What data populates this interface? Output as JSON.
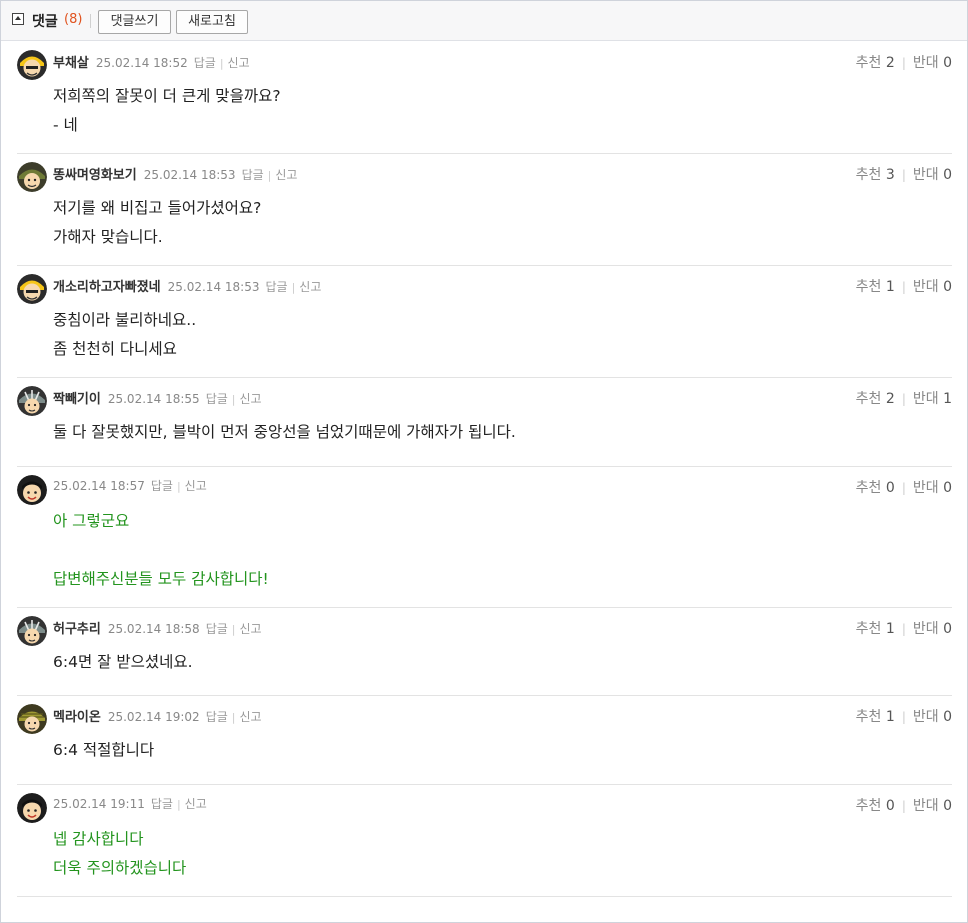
{
  "header": {
    "title": "댓글",
    "count": "(8)",
    "write_button": "댓글쓰기",
    "refresh_button": "새로고침"
  },
  "labels": {
    "reply": "답글",
    "report": "신고",
    "recommend": "추천",
    "oppose": "반대"
  },
  "comments": [
    {
      "nick": "부채살",
      "date": "25.02.14 18:52",
      "lines": [
        "저희쪽의 잘못이 더 큰게 맞을까요?",
        "- 네"
      ],
      "up": "2",
      "down": "0",
      "author": false,
      "avatar": "yellow-helmet-avatar"
    },
    {
      "nick": "똥싸며영화보기",
      "date": "25.02.14 18:53",
      "lines": [
        "저기를 왜 비집고 들어가셨어요?",
        "가해자 맞습니다."
      ],
      "up": "3",
      "down": "0",
      "author": false,
      "avatar": "green-helmet-avatar"
    },
    {
      "nick": "개소리하고자빠졌네",
      "date": "25.02.14 18:53",
      "lines": [
        "중침이라 불리하네요..",
        "좀 천천히 다니세요"
      ],
      "up": "1",
      "down": "0",
      "author": false,
      "avatar": "yellow-helmet-avatar"
    },
    {
      "nick": "짝빼기이",
      "date": "25.02.14 18:55",
      "lines": [
        "둘 다 잘못했지만, 블박이 먼저 중앙선을 넘었기때문에 가해자가 됩니다."
      ],
      "up": "2",
      "down": "1",
      "author": false,
      "avatar": "striped-helmet-avatar"
    },
    {
      "nick": "",
      "date": "25.02.14 18:57",
      "lines": [
        "아 그렇군요",
        "",
        "답변해주신분들 모두 감사합니다!"
      ],
      "up": "0",
      "down": "0",
      "author": true,
      "avatar": "black-hair-avatar"
    },
    {
      "nick": "허구추리",
      "date": "25.02.14 18:58",
      "lines": [
        "6:4면 잘 받으셨네요."
      ],
      "up": "1",
      "down": "0",
      "author": false,
      "avatar": "striped-helmet-avatar"
    },
    {
      "nick": "멕라이온",
      "date": "25.02.14 19:02",
      "lines": [
        "6:4 적절합니다"
      ],
      "up": "1",
      "down": "0",
      "author": false,
      "avatar": "olive-helmet-avatar"
    },
    {
      "nick": "",
      "date": "25.02.14 19:11",
      "lines": [
        "넵 감사합니다",
        "더욱 주의하겠습니다"
      ],
      "up": "0",
      "down": "0",
      "author": true,
      "avatar": "black-hair-avatar"
    }
  ],
  "colors": {
    "author_text": "#23941e",
    "count": "#e0531f"
  }
}
